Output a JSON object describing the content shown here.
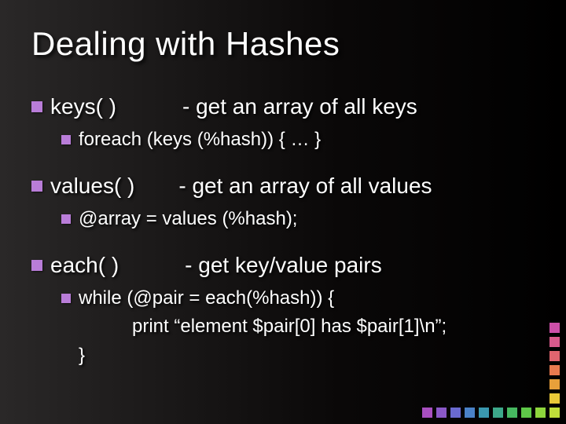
{
  "title": "Dealing with Hashes",
  "items": [
    {
      "label": "keys( )   - get an array of all keys",
      "sub": "foreach (keys (%hash))  { … }"
    },
    {
      "label": "values( )  - get an array of all values",
      "sub": "@array = values (%hash);"
    },
    {
      "label": "each( )   - get key/value pairs",
      "sub": "while (@pair = each(%hash)) {",
      "cont": "print “element $pair[0] has $pair[1]\\n”;",
      "close": "}"
    }
  ]
}
